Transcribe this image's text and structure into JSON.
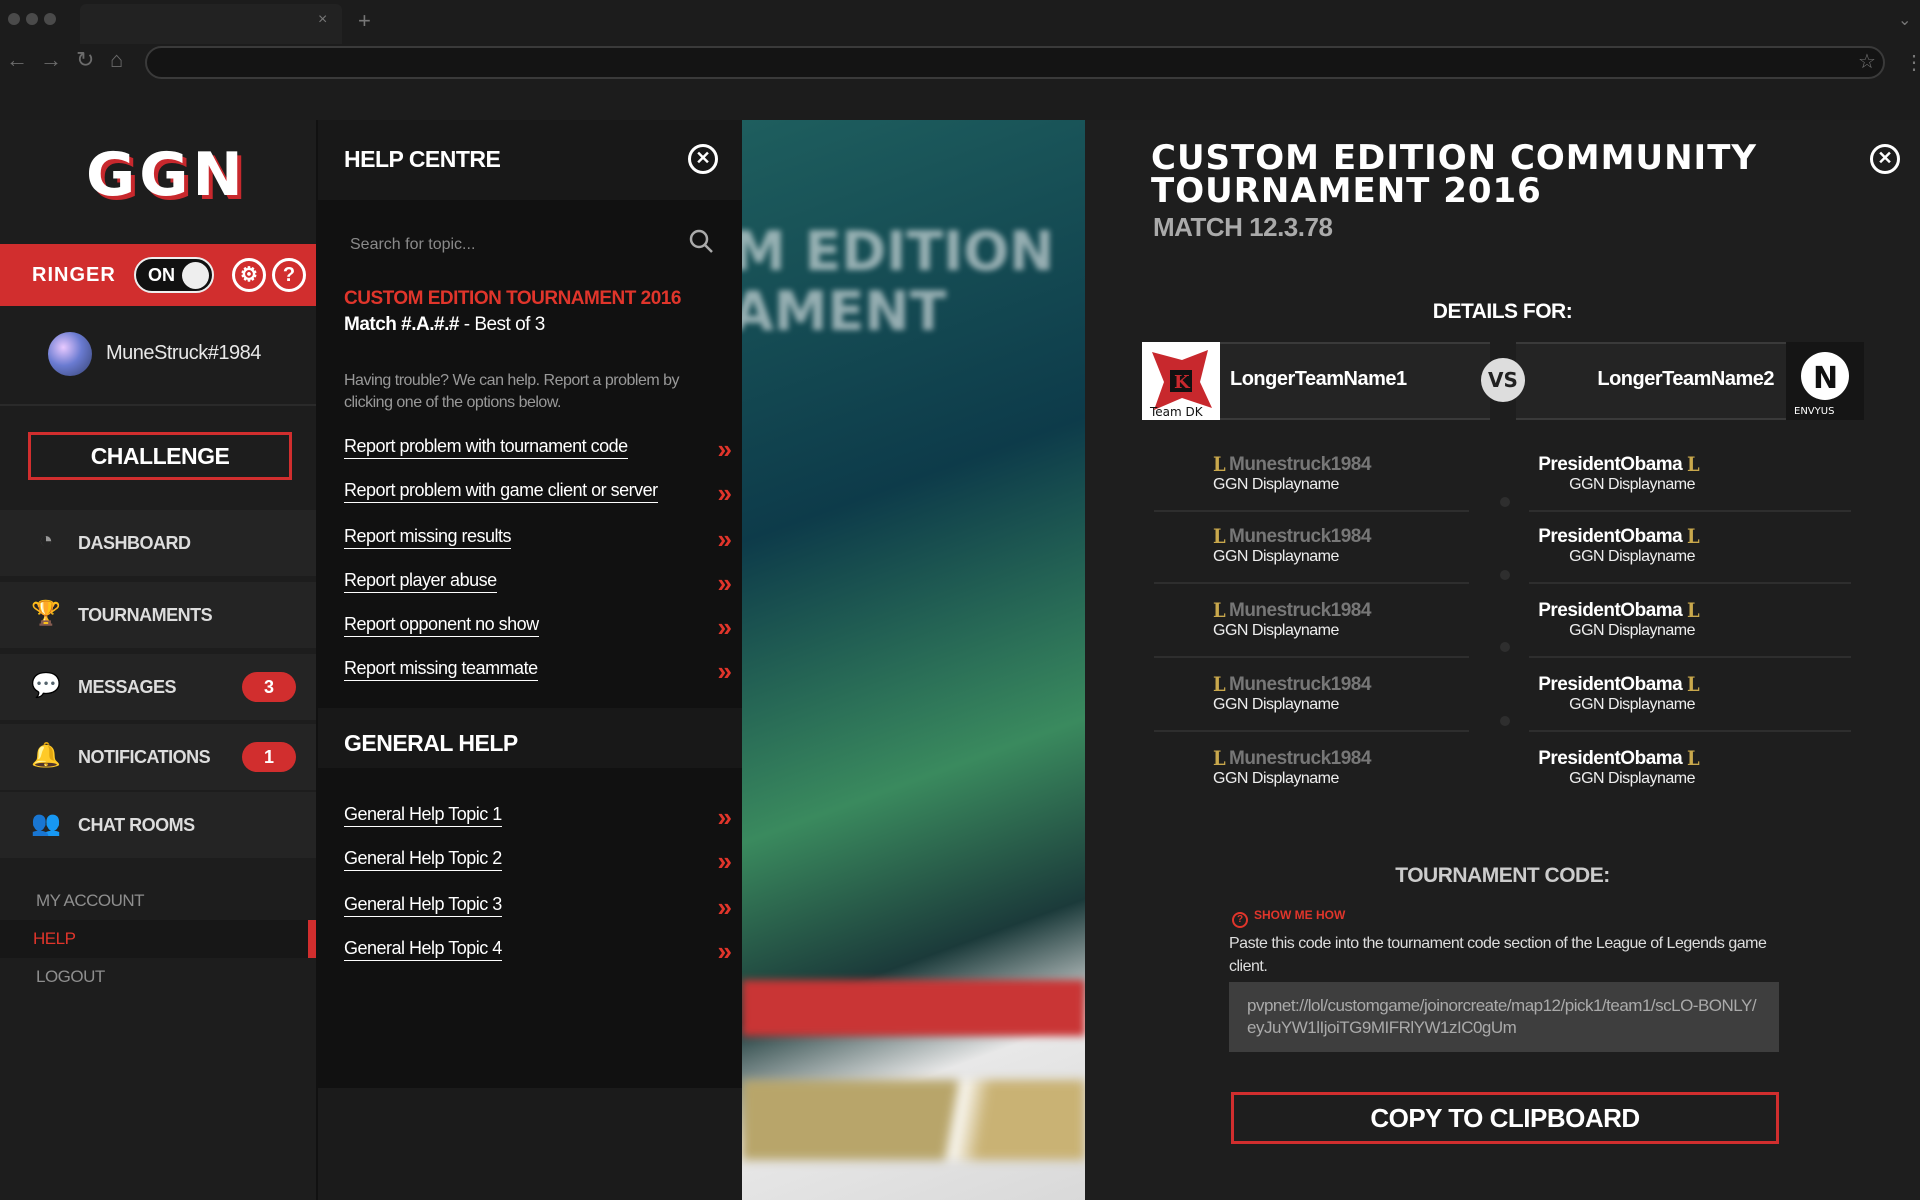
{
  "browser": {
    "tab_close": "×",
    "new_tab": "+",
    "back": "←",
    "forward": "→",
    "reload": "↻",
    "home": "⌂",
    "bookmark": "☆",
    "menu": "⋮",
    "tab_menu": "⌄",
    "url": ""
  },
  "sidebar": {
    "logo": "GGN",
    "ringer_label": "RINGER",
    "ringer_toggle": "ON",
    "username": "MuneStruck#1984",
    "challenge_label": "CHALLENGE",
    "nav": [
      {
        "label": "DASHBOARD",
        "icon": "gauge-icon"
      },
      {
        "label": "TOURNAMENTS",
        "icon": "trophy-icon"
      },
      {
        "label": "MESSAGES",
        "icon": "chat-icon",
        "badge": "3"
      },
      {
        "label": "NOTIFICATIONS",
        "icon": "bell-icon",
        "badge": "1"
      },
      {
        "label": "CHAT ROOMS",
        "icon": "people-icon"
      }
    ],
    "links": [
      {
        "label": "MY ACCOUNT"
      },
      {
        "label": "HELP",
        "active": true
      },
      {
        "label": "LOGOUT"
      }
    ]
  },
  "help": {
    "title": "HELP CENTRE",
    "search_placeholder": "Search for topic...",
    "tournament_title": "CUSTOM EDITION TOURNAMENT 2016",
    "match_label": "Match #.A.#.#",
    "match_suffix": " - Best of 3",
    "description": "Having trouble? We can help. Report a problem by clicking one of the options below.",
    "report_links": [
      "Report problem with tournament code",
      "Report problem with game client or server",
      "Report missing results",
      "Report player abuse",
      "Report opponent no show",
      "Report missing teammate"
    ],
    "general_title": "GENERAL HELP",
    "general_links": [
      "General Help Topic 1",
      "General Help Topic 2",
      "General Help Topic 3",
      "General Help Topic 4"
    ],
    "chevron": "»"
  },
  "details": {
    "title": "CUSTOM EDITION COMMUNITY TOURNAMENT 2016",
    "match": "MATCH 12.3.78",
    "details_for": "DETAILS FOR:",
    "team1": "LongerTeamName1",
    "team2": "LongerTeamName2",
    "team1_logo_text": "Team DK",
    "team2_logo_text": "ENVYUS",
    "vs": "VS",
    "players_left": [
      {
        "name": "Munestruck1984",
        "display": "GGN Displayname"
      },
      {
        "name": "Munestruck1984",
        "display": "GGN Displayname"
      },
      {
        "name": "Munestruck1984",
        "display": "GGN Displayname"
      },
      {
        "name": "Munestruck1984",
        "display": "GGN Displayname"
      },
      {
        "name": "Munestruck1984",
        "display": "GGN Displayname"
      }
    ],
    "players_right": [
      {
        "name": "PresidentObama",
        "display": "GGN Displayname"
      },
      {
        "name": "PresidentObama",
        "display": "GGN Displayname"
      },
      {
        "name": "PresidentObama",
        "display": "GGN Displayname"
      },
      {
        "name": "PresidentObama",
        "display": "GGN Displayname"
      },
      {
        "name": "PresidentObama",
        "display": "GGN Displayname"
      }
    ],
    "code_heading": "TOURNAMENT CODE:",
    "show_me_how": "SHOW ME HOW",
    "code_description": "Paste this code into the tournament code section of the League of Legends game client.",
    "code_value": "pvpnet://lol/customgame/joinorcreate/map12/pick1/team1/scLO-BONLY/eyJuYW1lIjoiTG9MIFRlYW1zIC0gUm",
    "copy_label": "COPY TO CLIPBOARD"
  },
  "colors": {
    "accent_red": "#d12e2e",
    "link_red": "#e0352b",
    "gold": "#c9a84c"
  }
}
